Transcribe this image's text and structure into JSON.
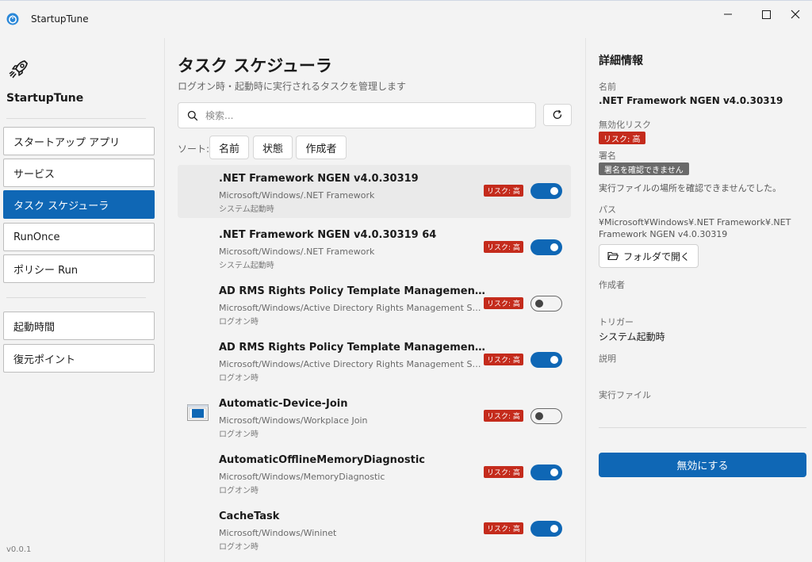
{
  "window": {
    "title": "StartupTune",
    "icon": "power-icon",
    "controls": [
      "minimize-icon",
      "maximize-icon",
      "close-icon"
    ]
  },
  "sidebar": {
    "brand": "StartupTune",
    "logo_icon": "rocket-icon",
    "nav_items": [
      {
        "label": "スタートアップ アプリ",
        "active": false
      },
      {
        "label": "サービス",
        "active": false
      },
      {
        "label": "タスク スケジューラ",
        "active": true
      },
      {
        "label": "RunOnce",
        "active": false
      },
      {
        "label": "ポリシー Run",
        "active": false
      }
    ],
    "tool_items": [
      {
        "label": "起動時間"
      },
      {
        "label": "復元ポイント"
      }
    ],
    "version": "v0.0.1"
  },
  "main": {
    "title": "タスク スケジューラ",
    "subtitle": "ログオン時・起動時に実行されるタスクを管理します",
    "search": {
      "placeholder": "検索...",
      "value": ""
    },
    "sort_label": "ソート:",
    "sort_buttons": [
      "名前",
      "状態",
      "作成者"
    ],
    "tasks": [
      {
        "name": ".NET Framework NGEN v4.0.30319",
        "path": "Microsoft/Windows/.NET Framework",
        "trigger": "システム起動時",
        "risk": "リスク: 高",
        "enabled": true,
        "selected": true,
        "icon": ""
      },
      {
        "name": ".NET Framework NGEN v4.0.30319 64",
        "path": "Microsoft/Windows/.NET Framework",
        "trigger": "システム起動時",
        "risk": "リスク: 高",
        "enabled": true,
        "selected": false,
        "icon": ""
      },
      {
        "name": "AD RMS Rights Policy Template Management (Automated)",
        "path": "Microsoft/Windows/Active Directory Rights Management Services Client",
        "trigger": "ログオン時",
        "risk": "リスク: 高",
        "enabled": false,
        "selected": false,
        "icon": ""
      },
      {
        "name": "AD RMS Rights Policy Template Management (Manual)",
        "path": "Microsoft/Windows/Active Directory Rights Management Services Client",
        "trigger": "ログオン時",
        "risk": "リスク: 高",
        "enabled": true,
        "selected": false,
        "icon": ""
      },
      {
        "name": "Automatic-Device-Join",
        "path": "Microsoft/Windows/Workplace Join",
        "trigger": "ログオン時",
        "risk": "リスク: 高",
        "enabled": false,
        "selected": false,
        "icon": "window-app-icon"
      },
      {
        "name": "AutomaticOfflineMemoryDiagnostic",
        "path": "Microsoft/Windows/MemoryDiagnostic",
        "trigger": "ログオン時",
        "risk": "リスク: 高",
        "enabled": true,
        "selected": false,
        "icon": ""
      },
      {
        "name": "CacheTask",
        "path": "Microsoft/Windows/Wininet",
        "trigger": "ログオン時",
        "risk": "リスク: 高",
        "enabled": true,
        "selected": false,
        "icon": ""
      }
    ]
  },
  "detail": {
    "title": "詳細情報",
    "name_label": "名前",
    "name_value": ".NET Framework NGEN v4.0.30319",
    "risk_label": "無効化リスク",
    "risk_value": "リスク: 高",
    "signature_label": "署名",
    "signature_value": "署名を確認できません",
    "signature_note": "実行ファイルの場所を確認できませんでした。",
    "path_label": "パス",
    "path_value": "¥Microsoft¥Windows¥.NET Framework¥.NET Framework NGEN v4.0.30319",
    "open_folder_label": "フォルダで開く",
    "author_label": "作成者",
    "author_value": "",
    "trigger_label": "トリガー",
    "trigger_value": "システム起動時",
    "description_label": "説明",
    "description_value": "",
    "executable_label": "実行ファイル",
    "executable_value": "",
    "disable_label": "無効にする"
  },
  "colors": {
    "accent": "#0f67b5",
    "risk_high": "#c42b1c",
    "unsigned_badge": "#6a6a6a",
    "background": "#f3f3f3"
  }
}
